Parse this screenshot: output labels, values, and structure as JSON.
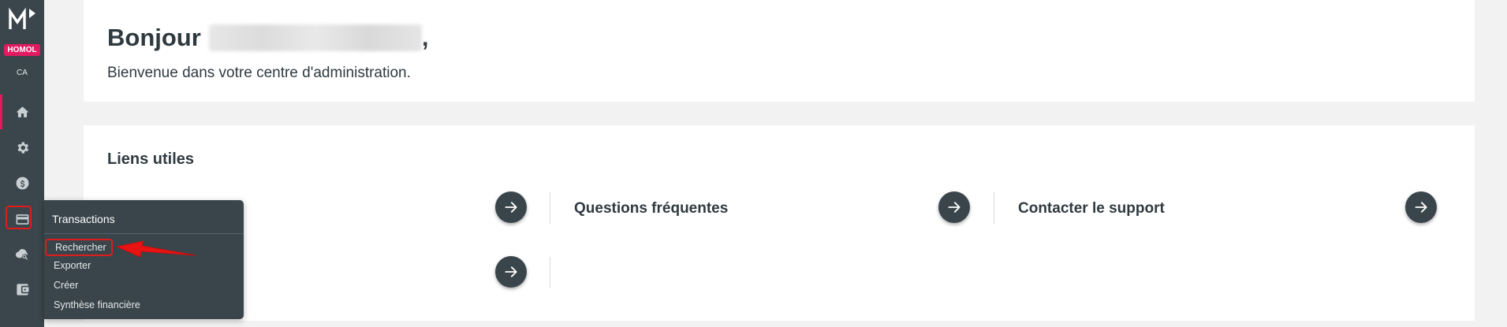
{
  "sidebar": {
    "logo": "M",
    "env_badge": "HOMOL",
    "env_sub": "CA",
    "accent_color": "#e5195f",
    "items": [
      {
        "icon": "home-icon"
      },
      {
        "icon": "gear-icon"
      },
      {
        "icon": "dollar-icon"
      },
      {
        "icon": "credit-card-icon"
      },
      {
        "icon": "cloud-search-icon"
      },
      {
        "icon": "wallet-icon"
      }
    ]
  },
  "welcome": {
    "greeting": "Bonjour",
    "comma": ",",
    "subtitle": "Bienvenue dans votre centre d'administration."
  },
  "links": {
    "title": "Liens utiles",
    "items": [
      {
        "label": "Questions fréquentes"
      },
      {
        "label": "Contacter le support"
      }
    ]
  },
  "flyout": {
    "title": "Transactions",
    "items": [
      "Rechercher",
      "Exporter",
      "Créer",
      "Synthèse financière"
    ]
  }
}
